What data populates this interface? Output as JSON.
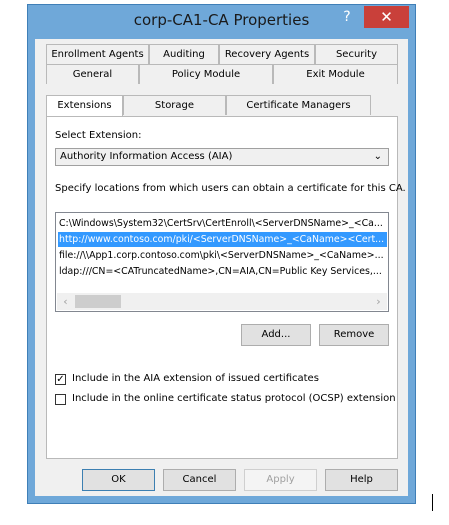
{
  "window": {
    "title": "corp-CA1-CA Properties",
    "help_glyph": "?",
    "close_glyph": "✕"
  },
  "tabs": {
    "row1": [
      "Enrollment Agents",
      "Auditing",
      "Recovery Agents",
      "Security"
    ],
    "row2": [
      "General",
      "Policy Module",
      "Exit Module"
    ],
    "row3": [
      "Extensions",
      "Storage",
      "Certificate Managers"
    ]
  },
  "extensions": {
    "select_label": "Select Extension:",
    "selected_extension": "Authority Information Access (AIA)",
    "description": "Specify locations from which users can obtain a certificate for this CA.",
    "locations": [
      "C:\\Windows\\System32\\CertSrv\\CertEnroll\\<ServerDNSName>_<Ca...",
      "http://www.contoso.com/pki/<ServerDNSName>_<CaName><Cert...",
      "file://\\\\App1.corp.contoso.com\\pki\\<ServerDNSName>_<CaName>...",
      "ldap:///CN=<CATruncatedName>,CN=AIA,CN=Public Key Services,..."
    ],
    "add_label": "Add...",
    "remove_label": "Remove",
    "checkbox_aia_label": "Include in the AIA extension of issued certificates",
    "checkbox_aia_checked": true,
    "checkbox_ocsp_label": "Include in the online certificate status protocol (OCSP) extension",
    "checkbox_ocsp_checked": false
  },
  "footer": {
    "ok": "OK",
    "cancel": "Cancel",
    "apply": "Apply",
    "help": "Help"
  },
  "colors": {
    "titlebar": "#6fa8d9",
    "close": "#c9403a",
    "selection": "#3399ff"
  }
}
